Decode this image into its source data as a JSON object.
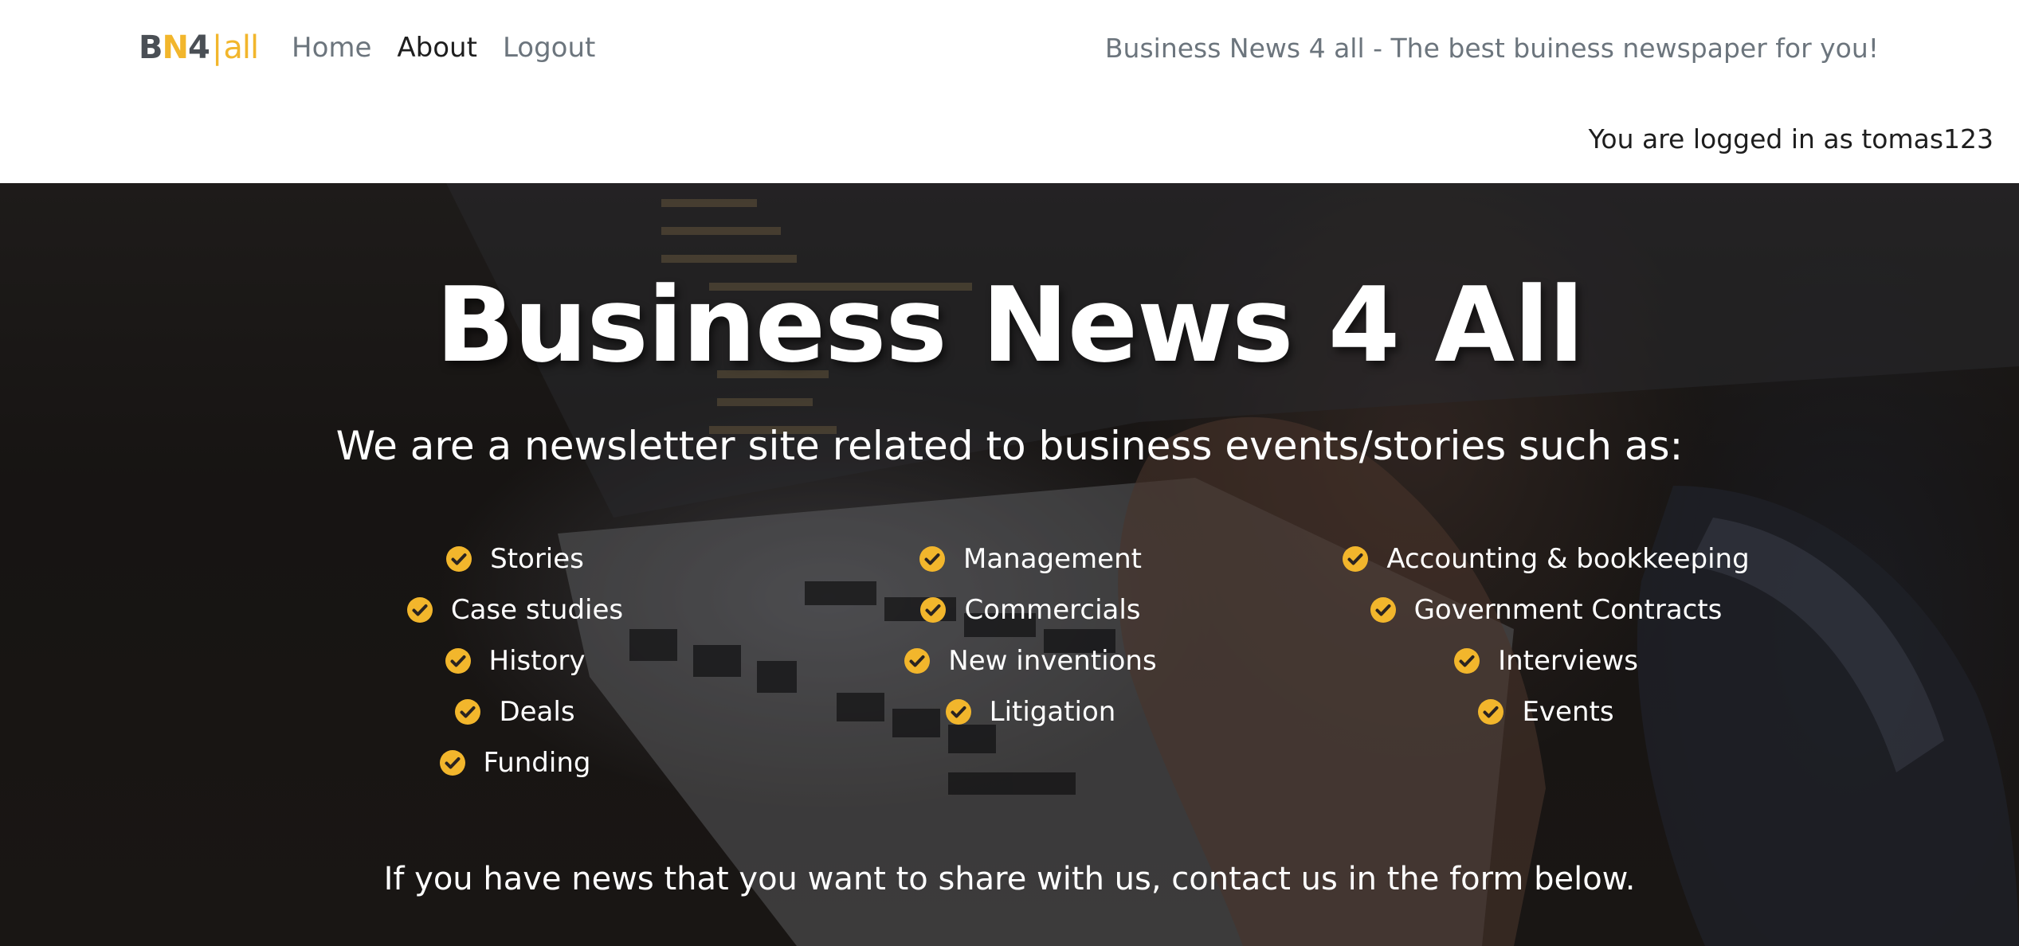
{
  "navbar": {
    "brand": {
      "b": "B",
      "n": "N",
      "four": "4",
      "bar": "|",
      "all": "all"
    },
    "links": [
      {
        "label": "Home",
        "active": false
      },
      {
        "label": "About",
        "active": true
      },
      {
        "label": "Logout",
        "active": false
      }
    ],
    "tagline": "Business News 4 all - The best buiness newspaper for you!",
    "login_status": "You are logged in as tomas123"
  },
  "hero": {
    "title": "Business News 4 All",
    "subtitle": "We are a newsletter site related to business events/stories such as:",
    "topics": {
      "col1": [
        "Stories",
        "Case studies",
        "History",
        "Deals",
        "Funding"
      ],
      "col2": [
        "Management",
        "Commercials",
        "New inventions",
        "Litigation"
      ],
      "col3": [
        "Accounting & bookkeeping",
        "Government Contracts",
        "Interviews",
        "Events"
      ]
    },
    "footer": "If you have news that you want to share with us, contact us in the form below."
  },
  "colors": {
    "accent": "#f2b62c",
    "muted_text": "#6c757d",
    "dark_text": "#1e1e1e"
  },
  "icons": {
    "topic_bullet": "check-circle-icon"
  }
}
